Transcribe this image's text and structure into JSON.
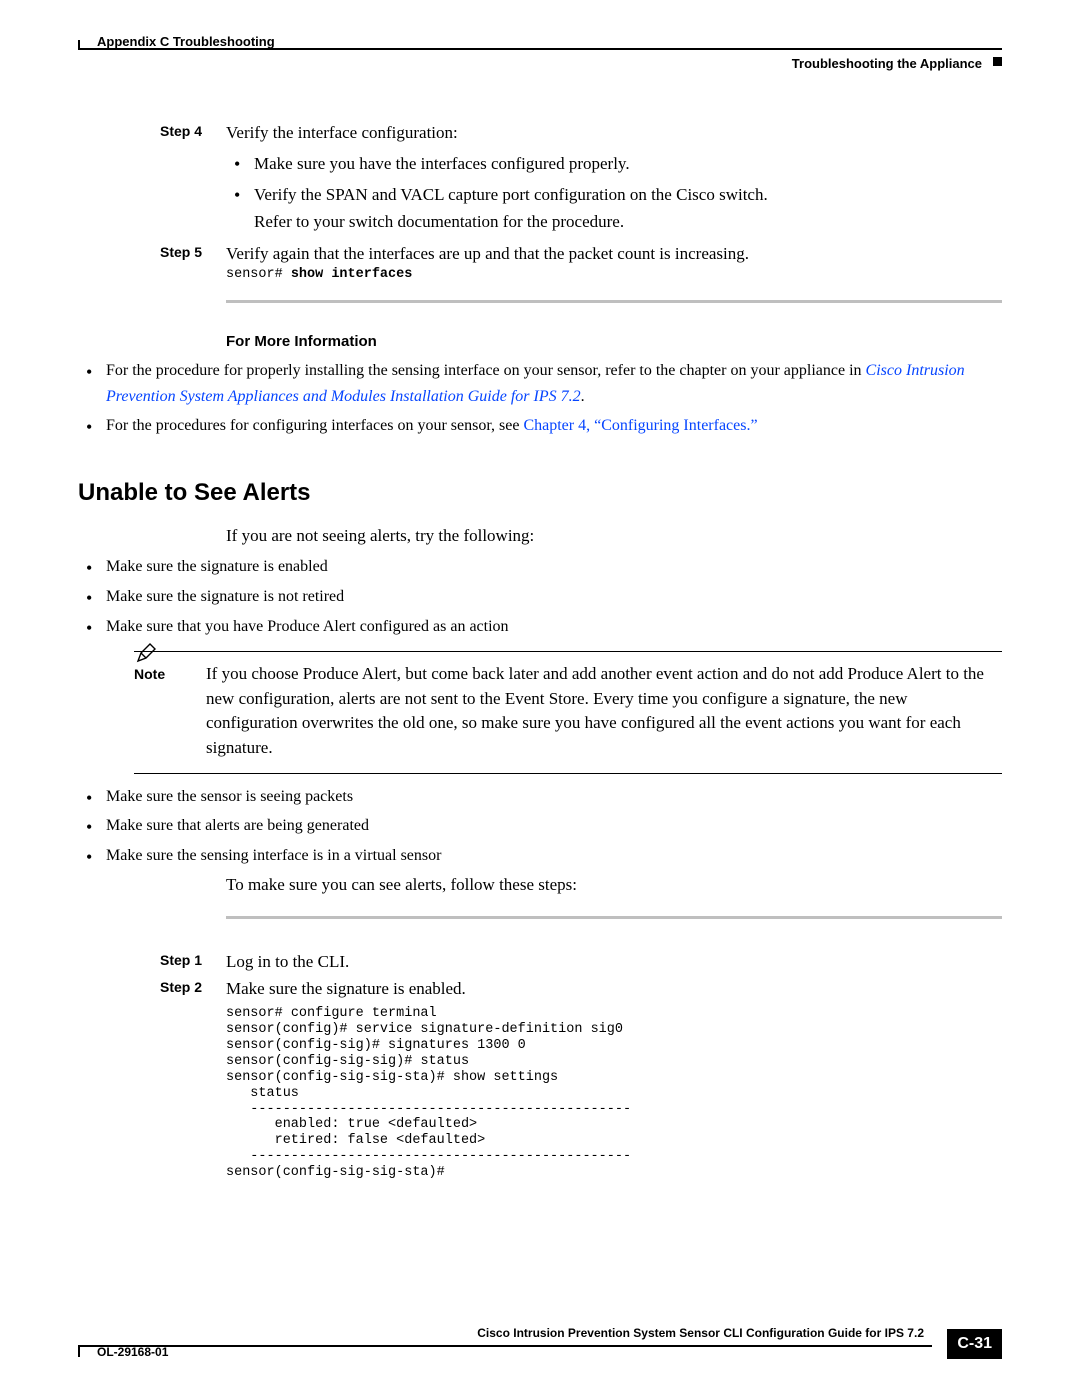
{
  "header": {
    "appendix": "Appendix C      Troubleshooting",
    "section": "Troubleshooting the Appliance"
  },
  "step4": {
    "label": "Step 4",
    "text": "Verify the interface configuration:",
    "b1": "Make sure you have the interfaces configured properly.",
    "b2a": "Verify the SPAN and VACL capture port configuration on the Cisco switch.",
    "b2b": "Refer to your switch documentation for the procedure."
  },
  "step5": {
    "label": "Step 5",
    "text": "Verify again that the interfaces are up and that the packet count is increasing.",
    "code_prompt": "sensor# ",
    "code_cmd": "show interfaces"
  },
  "fmi": {
    "heading": "For More Information",
    "b1_pre": "For the procedure for properly installing the sensing interface on your sensor, refer to the chapter on your appliance in ",
    "b1_link": "Cisco Intrusion Prevention System Appliances and Modules Installation Guide for IPS 7.2",
    "b1_post": ".",
    "b2_pre": "For the procedures for configuring interfaces on your sensor, see ",
    "b2_link": "Chapter 4, “Configuring Interfaces.”"
  },
  "alerts": {
    "heading": "Unable to See Alerts",
    "intro": "If you are not seeing alerts, try the following:",
    "b1": "Make sure the signature is enabled",
    "b2": "Make sure the signature is not retired",
    "b3": "Make sure that you have Produce Alert configured as an action",
    "note_label": "Note",
    "note_body": "If you choose Produce Alert, but come back later and add another event action and do not add Produce Alert to the new configuration, alerts are not sent to the Event Store. Every time you configure a signature, the new configuration overwrites the old one, so make sure you have configured all the event actions you want for each signature.",
    "b4": "Make sure the sensor is seeing packets",
    "b5": "Make sure that alerts are being generated",
    "b6": "Make sure the sensing interface is in a virtual sensor",
    "followup": "To make sure you can see alerts, follow these steps:"
  },
  "stepsB": {
    "s1_label": "Step 1",
    "s1_text": "Log in to the CLI.",
    "s2_label": "Step 2",
    "s2_text": "Make sure the signature is enabled.",
    "code": "sensor# configure terminal\nsensor(config)# service signature-definition sig0\nsensor(config-sig)# signatures 1300 0\nsensor(config-sig-sig)# status\nsensor(config-sig-sig-sta)# show settings\n   status\n   -----------------------------------------------\n      enabled: true <defaulted>\n      retired: false <defaulted>\n   -----------------------------------------------\nsensor(config-sig-sig-sta)#",
    "code_l1_p": "sensor# ",
    "code_l1_c": "configure terminal",
    "code_l2_p": "sensor(config)# ",
    "code_l2_c": "service signature-definition sig0",
    "code_l3_p": "sensor(config-sig)# ",
    "code_l3_c": "signatures 1300 0",
    "code_l4_p": "sensor(config-sig-sig)# ",
    "code_l4_c": "status",
    "code_l5_p": "sensor(config-sig-sig-sta)# ",
    "code_l5_c": "show settings",
    "code_l6": "   status",
    "code_l7": "   -----------------------------------------------",
    "code_l8": "      enabled: true <defaulted>",
    "code_l9": "      retired: false <defaulted>",
    "code_l10": "   -----------------------------------------------",
    "code_l11": "sensor(config-sig-sig-sta)#"
  },
  "footer": {
    "guide": "Cisco Intrusion Prevention System Sensor CLI Configuration Guide for IPS 7.2",
    "docnum": "OL-29168-01",
    "page": "C-31"
  }
}
